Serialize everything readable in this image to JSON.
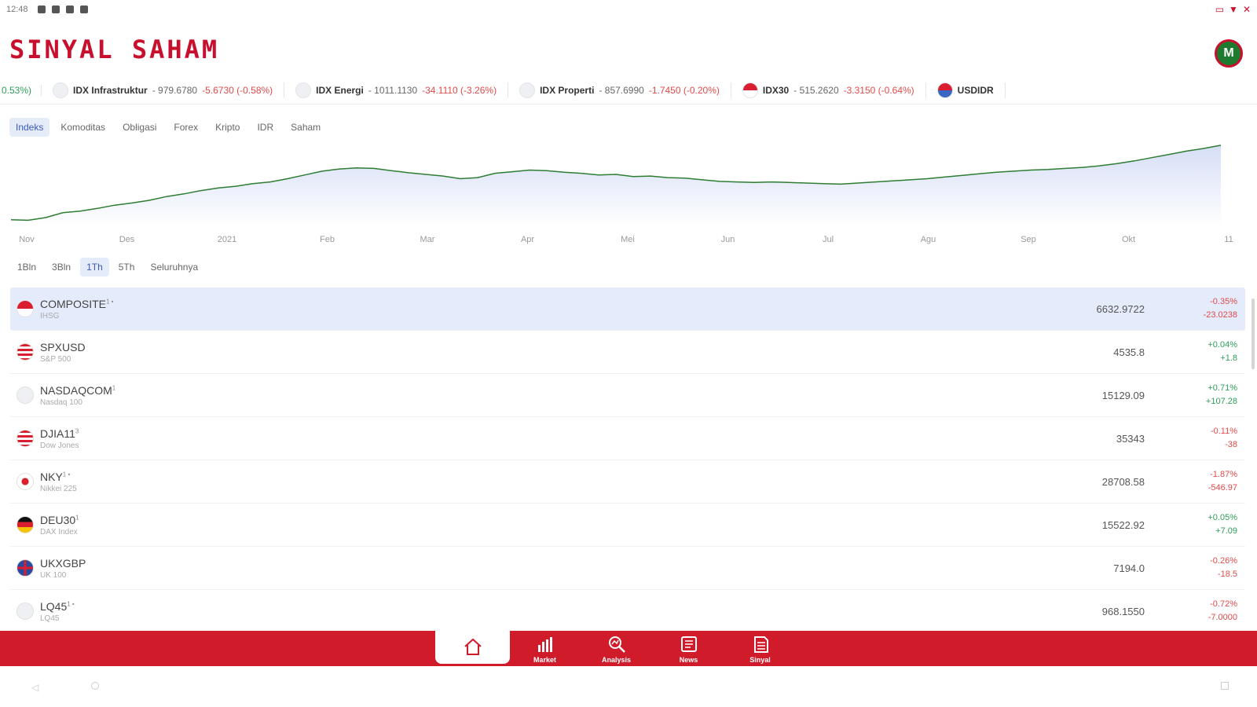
{
  "status_bar": {
    "time": "12:48"
  },
  "app": {
    "logo": "SINYAL SAHAM",
    "avatar_letter": "M"
  },
  "ticker": {
    "lead_text": "0.53%)",
    "items": [
      {
        "name": "IDX Infrastruktur",
        "value": "979.6780",
        "change": "-5.6730 (-0.58%)",
        "flag": "none"
      },
      {
        "name": "IDX Energi",
        "value": "1011.1130",
        "change": "-34.1110 (-3.26%)",
        "flag": "none"
      },
      {
        "name": "IDX Properti",
        "value": "857.6990",
        "change": "-1.7450 (-0.20%)",
        "flag": "none"
      },
      {
        "name": "IDX30",
        "value": "515.2620",
        "change": "-3.3150 (-0.64%)",
        "flag": "id"
      },
      {
        "name": "USDIDR",
        "value": "",
        "change": "",
        "flag": "us"
      }
    ]
  },
  "category_tabs": [
    "Indeks",
    "Komoditas",
    "Obligasi",
    "Forex",
    "Kripto",
    "IDR",
    "Saham"
  ],
  "active_category": "Indeks",
  "chart_data": {
    "type": "area",
    "x_labels": [
      "Nov",
      "Des",
      "2021",
      "Feb",
      "Mar",
      "Apr",
      "Mei",
      "Jun",
      "Jul",
      "Agu",
      "Sep",
      "Okt",
      "11"
    ],
    "values": [
      5020,
      5010,
      5060,
      5150,
      5180,
      5230,
      5290,
      5330,
      5380,
      5450,
      5500,
      5560,
      5610,
      5640,
      5690,
      5720,
      5780,
      5850,
      5920,
      5960,
      5980,
      5970,
      5930,
      5890,
      5860,
      5830,
      5780,
      5800,
      5880,
      5910,
      5940,
      5930,
      5900,
      5880,
      5850,
      5860,
      5820,
      5830,
      5800,
      5790,
      5760,
      5730,
      5720,
      5710,
      5720,
      5710,
      5700,
      5690,
      5680,
      5700,
      5720,
      5740,
      5760,
      5780,
      5810,
      5840,
      5870,
      5900,
      5920,
      5940,
      5950,
      5970,
      5990,
      6020,
      6060,
      6110,
      6170,
      6230,
      6290,
      6340,
      6400
    ],
    "ylim": [
      4900,
      6500
    ],
    "line_color": "#2e7d32",
    "fill_top_color": "#d6def7"
  },
  "range_tabs": [
    "1Bln",
    "3Bln",
    "1Th",
    "5Th",
    "Seluruhnya"
  ],
  "active_range": "1Th",
  "indices": [
    {
      "symbol": "COMPOSITE",
      "sup": "1 •",
      "desc": "IHSG",
      "price": "6632.9722",
      "pct": "-0.35%",
      "abs": "-23.0238",
      "dir": "down",
      "flag": "id",
      "selected": true
    },
    {
      "symbol": "SPXUSD",
      "sup": "",
      "desc": "S&P 500",
      "price": "4535.8",
      "pct": "+0.04%",
      "abs": "+1.8",
      "dir": "up",
      "flag": "us",
      "selected": false
    },
    {
      "symbol": "NASDAQCOM",
      "sup": "1",
      "desc": "Nasdaq 100",
      "price": "15129.09",
      "pct": "+0.71%",
      "abs": "+107.28",
      "dir": "up",
      "flag": "none",
      "selected": false
    },
    {
      "symbol": "DJIA11",
      "sup": "3",
      "desc": "Dow Jones",
      "price": "35343",
      "pct": "-0.11%",
      "abs": "-38",
      "dir": "down",
      "flag": "us",
      "selected": false
    },
    {
      "symbol": "NKY",
      "sup": "1 •",
      "desc": "Nikkei 225",
      "price": "28708.58",
      "pct": "-1.87%",
      "abs": "-546.97",
      "dir": "down",
      "flag": "jp",
      "selected": false
    },
    {
      "symbol": "DEU30",
      "sup": "1",
      "desc": "DAX Index",
      "price": "15522.92",
      "pct": "+0.05%",
      "abs": "+7.09",
      "dir": "up",
      "flag": "de",
      "selected": false
    },
    {
      "symbol": "UKXGBP",
      "sup": "",
      "desc": "UK 100",
      "price": "7194.0",
      "pct": "-0.26%",
      "abs": "-18.5",
      "dir": "down",
      "flag": "uk",
      "selected": false
    },
    {
      "symbol": "LQ45",
      "sup": "1 •",
      "desc": "LQ45",
      "price": "968.1550",
      "pct": "-0.72%",
      "abs": "-7.0000",
      "dir": "down",
      "flag": "none",
      "selected": false
    }
  ],
  "bottom_nav": [
    {
      "label": "",
      "icon": "home-icon",
      "active": true
    },
    {
      "label": "Market",
      "icon": "market-icon",
      "active": false
    },
    {
      "label": "Analysis",
      "icon": "analysis-icon",
      "active": false
    },
    {
      "label": "News",
      "icon": "news-icon",
      "active": false
    },
    {
      "label": "Sinyal",
      "icon": "signal-icon",
      "active": false
    }
  ]
}
